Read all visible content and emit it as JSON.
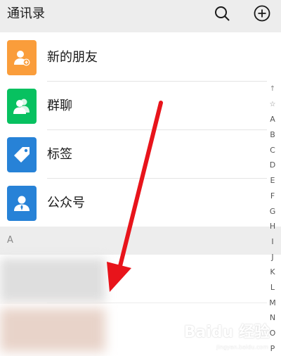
{
  "header": {
    "title": "通讯录",
    "search_icon": "search-icon",
    "add_icon": "plus-circle-icon"
  },
  "entries": [
    {
      "label": "新的朋友",
      "icon": "add-friend-icon",
      "color": "#fa9d3b"
    },
    {
      "label": "群聊",
      "icon": "group-icon",
      "color": "#07c160"
    },
    {
      "label": "标签",
      "icon": "tag-icon",
      "color": "#2782d7"
    },
    {
      "label": "公众号",
      "icon": "person-icon",
      "color": "#2782d7"
    }
  ],
  "section": {
    "letter": "A"
  },
  "index_bar": [
    "↑",
    "☆",
    "A",
    "B",
    "C",
    "D",
    "E",
    "F",
    "G",
    "H",
    "I",
    "J",
    "K",
    "L",
    "M",
    "N",
    "O",
    "P"
  ],
  "annotation": {
    "arrow_color": "#e8141b"
  },
  "watermark": {
    "text": "Baidu 经验",
    "sub": "jingyan.baidu.com"
  }
}
